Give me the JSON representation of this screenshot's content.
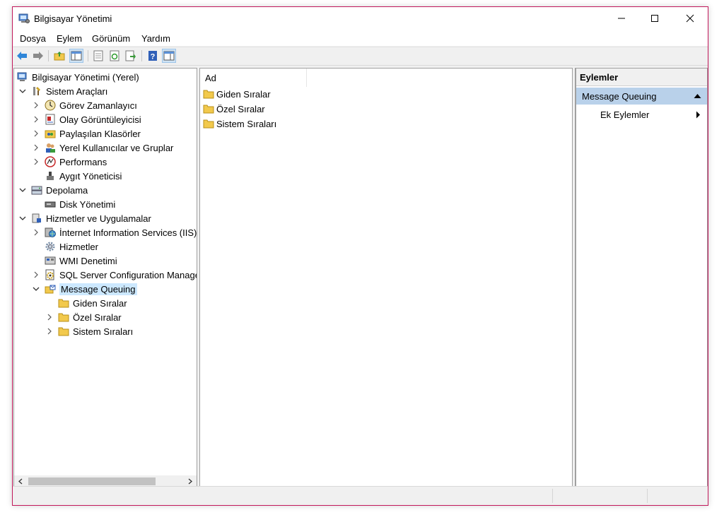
{
  "window": {
    "title": "Bilgisayar Yönetimi"
  },
  "menu": [
    "Dosya",
    "Eylem",
    "Görünüm",
    "Yardım"
  ],
  "tree": {
    "root": "Bilgisayar Yönetimi (Yerel)",
    "items": [
      "Sistem Araçları",
      "Görev Zamanlayıcı",
      "Olay Görüntüleyicisi",
      "Paylaşılan Klasörler",
      "Yerel Kullanıcılar ve Gruplar",
      "Performans",
      "Aygıt Yöneticisi",
      "Depolama",
      "Disk Yönetimi",
      "Hizmetler ve Uygulamalar",
      "İnternet Information Services (IIS)",
      "Hizmetler",
      "WMI Denetimi",
      "SQL Server Configuration Manager",
      "Message Queuing",
      "Giden Sıralar",
      "Özel Sıralar",
      "Sistem Sıraları"
    ]
  },
  "list": {
    "column": "Ad",
    "items": [
      "Giden Sıralar",
      "Özel Sıralar",
      "Sistem Sıraları"
    ]
  },
  "actions": {
    "title": "Eylemler",
    "section": "Message Queuing",
    "more": "Ek Eylemler"
  },
  "colors": {
    "accent": "#c2185b",
    "selection": "#cce8ff",
    "actions_header": "#b9d1ea"
  }
}
